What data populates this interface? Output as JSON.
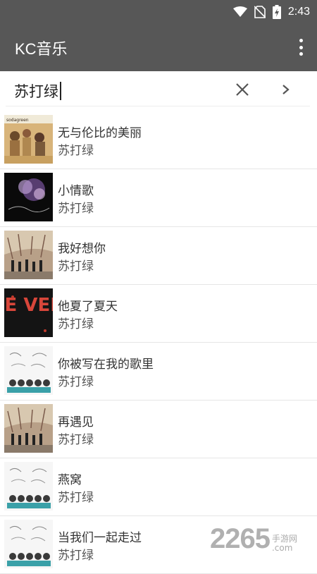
{
  "status_bar": {
    "time": "2:43",
    "icons": [
      "wifi-icon",
      "no-sim-icon",
      "battery-charging-icon"
    ]
  },
  "app_bar": {
    "title": "KC音乐",
    "menu_icon": "more-vert-icon"
  },
  "search": {
    "value": "苏打绿",
    "clear_icon": "close-icon",
    "go_icon": "chevron-right-icon"
  },
  "songs": [
    {
      "title": "无与伦比的美丽",
      "artist": "苏打绿",
      "cover_label": "sodagreen"
    },
    {
      "title": "小情歌",
      "artist": "苏打绿"
    },
    {
      "title": "我好想你",
      "artist": "苏打绿"
    },
    {
      "title": "他夏了夏天",
      "artist": "苏打绿",
      "cover_label": "FE VER"
    },
    {
      "title": "你被写在我的歌里",
      "artist": "苏打绿"
    },
    {
      "title": "再遇见",
      "artist": "苏打绿"
    },
    {
      "title": "燕窝",
      "artist": "苏打绿"
    },
    {
      "title": "当我们一起走过",
      "artist": "苏打绿"
    }
  ],
  "watermark": {
    "number": "2265",
    "text": "手游网",
    "domain": ".com"
  },
  "colors": {
    "bar": "#575757",
    "divider": "#e6e6e6",
    "text_primary": "#333333",
    "text_secondary": "#555555"
  }
}
